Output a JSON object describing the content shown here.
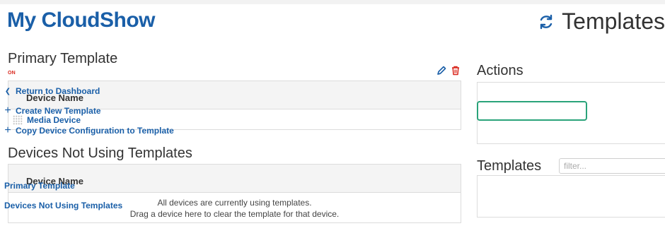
{
  "app": {
    "title": "My CloudShow"
  },
  "page": {
    "title": "Templates",
    "icon": "refresh-icon"
  },
  "primary": {
    "title": "Primary Template",
    "badge": "ON",
    "column_header": "Device Name",
    "rows": [
      {
        "name": "Media Device"
      }
    ]
  },
  "not_using": {
    "title": "Devices Not Using Templates",
    "column_header": "Device Name",
    "empty_line1": "All devices are currently using templates.",
    "empty_line2": "Drag a device here to clear the template for that device."
  },
  "actions": {
    "title": "Actions",
    "items": [
      {
        "label": "Return to Dashboard",
        "icon": "chevron-left-icon"
      },
      {
        "label": "Create New Template",
        "icon": "plus-icon"
      },
      {
        "label": "Copy Device Configuration to Template",
        "icon": "plus-icon"
      }
    ]
  },
  "templates": {
    "title": "Templates",
    "filter_placeholder": "filter...",
    "items": [
      {
        "label": "Primary Template"
      },
      {
        "label": "Devices Not Using Templates"
      }
    ]
  },
  "colors": {
    "brand": "#1a5fa8",
    "highlight": "#2aa37a",
    "danger": "#d9261c"
  }
}
